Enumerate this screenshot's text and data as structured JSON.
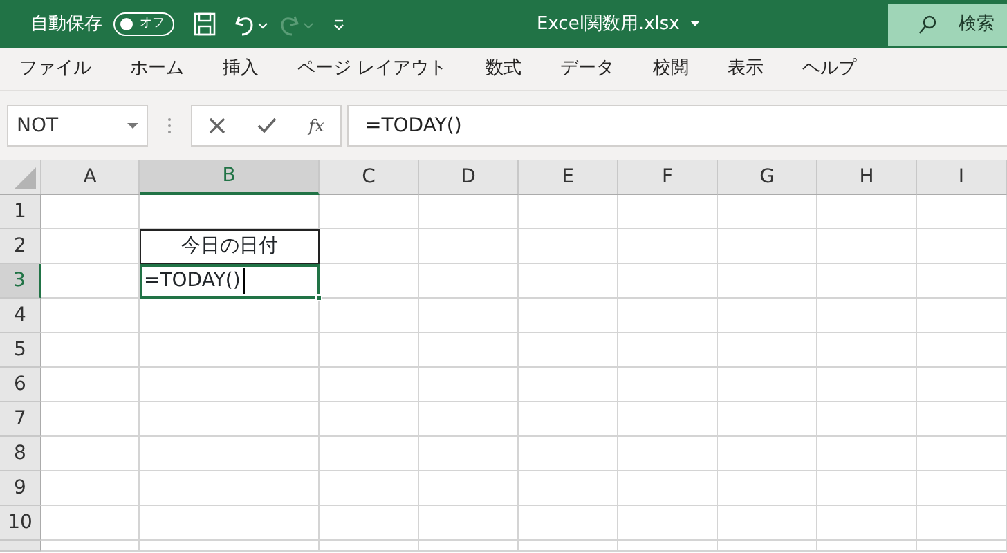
{
  "title_bar": {
    "autosave_label": "自動保存",
    "autosave_toggle": {
      "text": "オフ",
      "on": false
    },
    "redo_disabled": true,
    "filename": "Excel関数用.xlsx",
    "search": "検索"
  },
  "ribbon_tabs": [
    "ファイル",
    "ホーム",
    "挿入",
    "ページ レイアウト",
    "数式",
    "データ",
    "校閲",
    "表示",
    "ヘルプ"
  ],
  "formula_bar": {
    "name_box": "NOT",
    "function_button": "fx",
    "formula": "=TODAY()"
  },
  "sheet": {
    "columns": [
      {
        "label": "A",
        "selected": false
      },
      {
        "label": "B",
        "selected": true
      },
      {
        "label": "C",
        "selected": false
      },
      {
        "label": "D",
        "selected": false
      },
      {
        "label": "E",
        "selected": false
      },
      {
        "label": "F",
        "selected": false
      },
      {
        "label": "G",
        "selected": false
      },
      {
        "label": "H",
        "selected": false
      },
      {
        "label": "I",
        "selected": false
      }
    ],
    "rows": [
      {
        "label": "1",
        "selected": false
      },
      {
        "label": "2",
        "selected": false,
        "cells": [
          {
            "kind": "empty"
          },
          {
            "kind": "bordered",
            "text": "今日の日付"
          }
        ]
      },
      {
        "label": "3",
        "selected": true,
        "cells": [
          {
            "kind": "empty"
          },
          {
            "kind": "editing",
            "text": "=TODAY()"
          }
        ]
      },
      {
        "label": "4",
        "selected": false
      },
      {
        "label": "5",
        "selected": false
      },
      {
        "label": "6",
        "selected": false
      },
      {
        "label": "7",
        "selected": false
      },
      {
        "label": "8",
        "selected": false
      },
      {
        "label": "9",
        "selected": false
      },
      {
        "label": "10",
        "selected": false
      }
    ]
  }
}
